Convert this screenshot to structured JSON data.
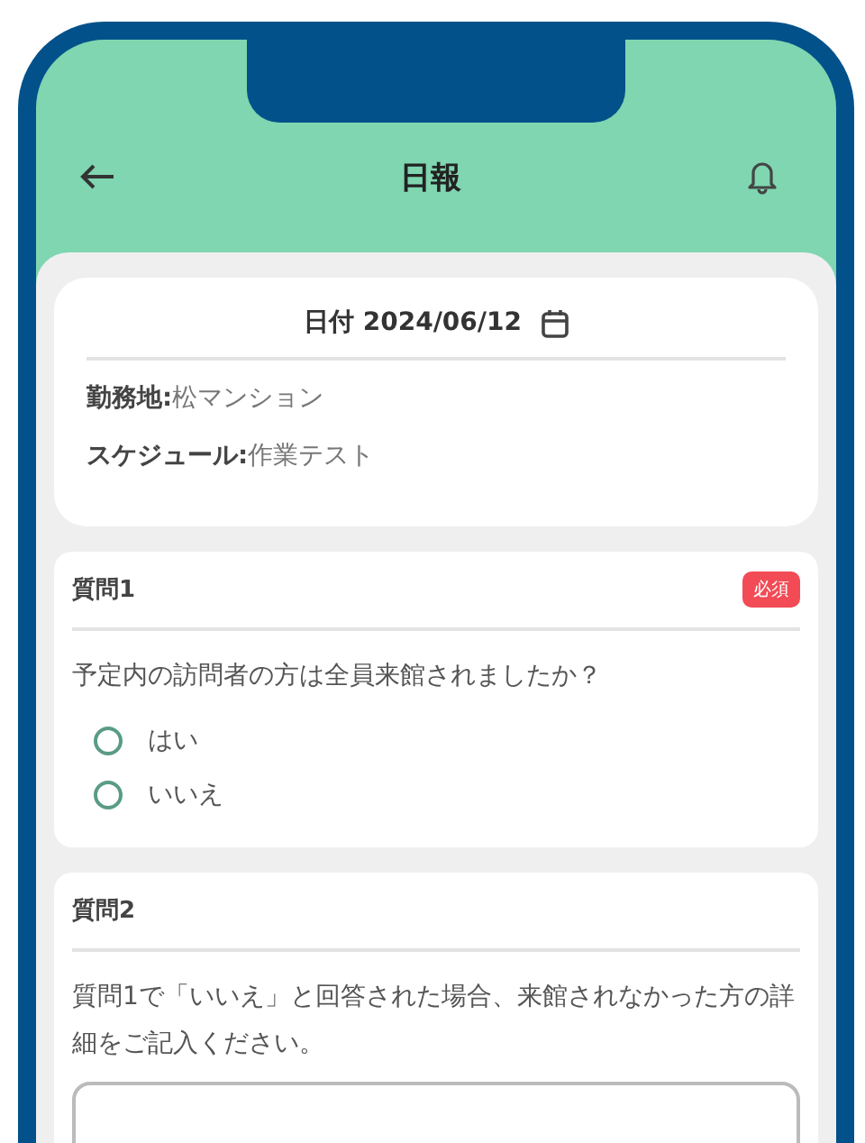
{
  "header": {
    "title": "日報"
  },
  "info_card": {
    "date": "日付 2024/06/12",
    "fields": [
      {
        "label": "勤務地:",
        "value": "松マンション"
      },
      {
        "label": "スケジュール:",
        "value": "作業テスト"
      }
    ]
  },
  "questions": [
    {
      "title": "質問1",
      "required": true,
      "badge": "必須",
      "text": "予定内の訪問者の方は全員来館されましたか？",
      "kind": "radio",
      "options": [
        {
          "label": "はい",
          "selected": false
        },
        {
          "label": "いいえ",
          "selected": false
        }
      ]
    },
    {
      "title": "質問2",
      "required": false,
      "text": "質問1で「いいえ」と回答された場合、来館されなかった方の詳細をご記入ください。",
      "kind": "textarea"
    }
  ]
}
